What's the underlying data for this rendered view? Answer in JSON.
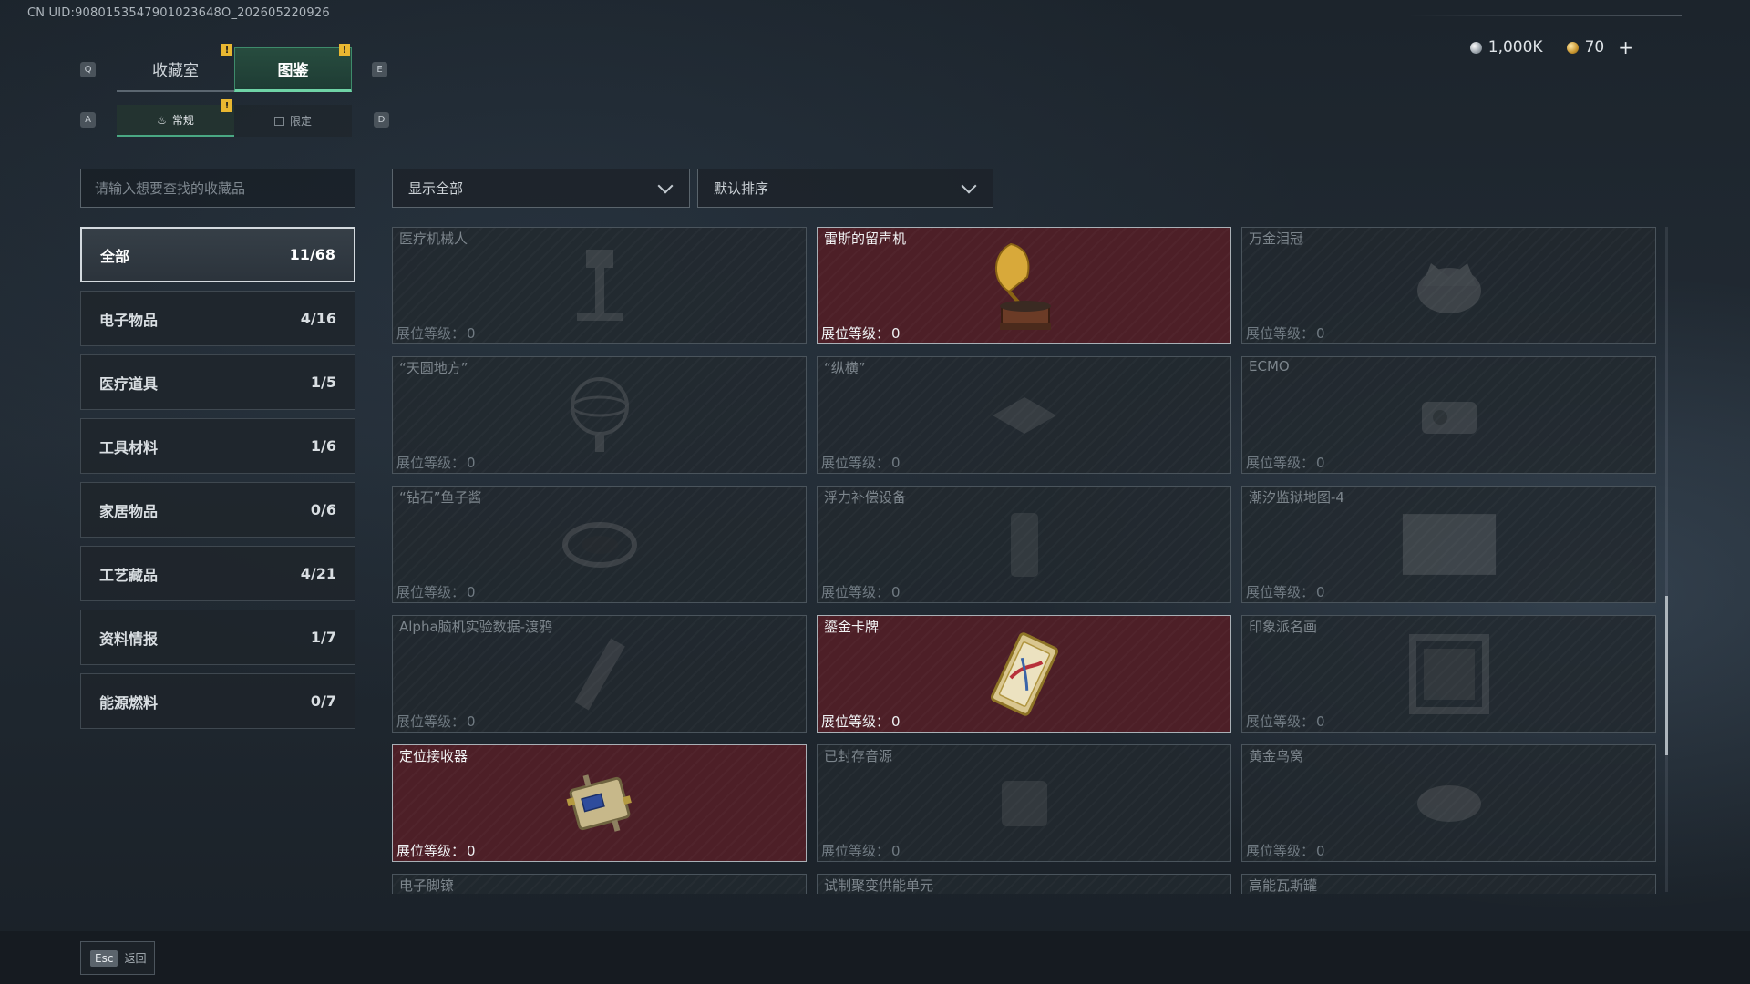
{
  "uid_text": "CN UID:9080153547901023648O_202605220926",
  "currency": {
    "silver": "1,000K",
    "gold": "70",
    "add": "+"
  },
  "key_hints": {
    "prev_tab": "Q",
    "next_tab": "E",
    "prev_sub": "A",
    "next_sub": "D"
  },
  "tabs": [
    {
      "label": "收藏室",
      "active": false,
      "badge": "!"
    },
    {
      "label": "图鉴",
      "active": true,
      "badge": "!"
    }
  ],
  "subtabs": [
    {
      "label": "常规",
      "active": true,
      "badge": "!"
    },
    {
      "label": "限定",
      "active": false
    }
  ],
  "search": {
    "placeholder": "请输入想要查找的收藏品"
  },
  "filters": {
    "display": "显示全部",
    "sort": "默认排序"
  },
  "categories": [
    {
      "label": "全部",
      "count": "11/68",
      "active": true
    },
    {
      "label": "电子物品",
      "count": "4/16"
    },
    {
      "label": "医疗道具",
      "count": "1/5"
    },
    {
      "label": "工具材料",
      "count": "1/6"
    },
    {
      "label": "家居物品",
      "count": "0/6"
    },
    {
      "label": "工艺藏品",
      "count": "4/21"
    },
    {
      "label": "资料情报",
      "count": "1/7"
    },
    {
      "label": "能源燃料",
      "count": "0/7"
    }
  ],
  "level_label": "展位等级：",
  "items": [
    {
      "name": "医疗机械人",
      "level": "0",
      "owned": false,
      "icon": "medical-robot-icon"
    },
    {
      "name": "雷斯的留声机",
      "level": "0",
      "owned": true,
      "icon": "gramophone-icon"
    },
    {
      "name": "万金泪冠",
      "level": "0",
      "owned": false,
      "icon": "crown-icon"
    },
    {
      "name": "“天圆地方”",
      "level": "0",
      "owned": false,
      "icon": "armillary-icon"
    },
    {
      "name": "“纵横”",
      "level": "0",
      "owned": false,
      "icon": "chessboard-icon"
    },
    {
      "name": "ECMO",
      "level": "0",
      "owned": false,
      "icon": "ecmo-icon"
    },
    {
      "name": "“钻石”鱼子酱",
      "level": "0",
      "owned": false,
      "icon": "caviar-icon"
    },
    {
      "name": "浮力补偿设备",
      "level": "0",
      "owned": false,
      "icon": "buoyancy-device-icon"
    },
    {
      "name": "潮汐监狱地图-4",
      "level": "0",
      "owned": false,
      "icon": "map-icon"
    },
    {
      "name": "Alpha脑机实验数据-渡鸦",
      "level": "0",
      "owned": false,
      "icon": "data-drive-icon"
    },
    {
      "name": "鎏金卡牌",
      "level": "0",
      "owned": true,
      "icon": "gold-card-icon"
    },
    {
      "name": "印象派名画",
      "level": "0",
      "owned": false,
      "icon": "painting-icon"
    },
    {
      "name": "定位接收器",
      "level": "0",
      "owned": true,
      "icon": "locator-receiver-icon"
    },
    {
      "name": "已封存音源",
      "level": "0",
      "owned": false,
      "icon": "sealed-audio-icon"
    },
    {
      "name": "黄金鸟窝",
      "level": "0",
      "owned": false,
      "icon": "golden-nest-icon"
    },
    {
      "name": "电子脚镣",
      "level": "",
      "owned": false,
      "icon": "ankle-monitor-icon"
    },
    {
      "name": "试制聚变供能单元",
      "level": "",
      "owned": false,
      "icon": "fusion-cell-icon"
    },
    {
      "name": "高能瓦斯罐",
      "level": "",
      "owned": false,
      "icon": "gas-tank-icon"
    }
  ],
  "footer": {
    "esc_key": "Esc",
    "back_label": "返回"
  }
}
